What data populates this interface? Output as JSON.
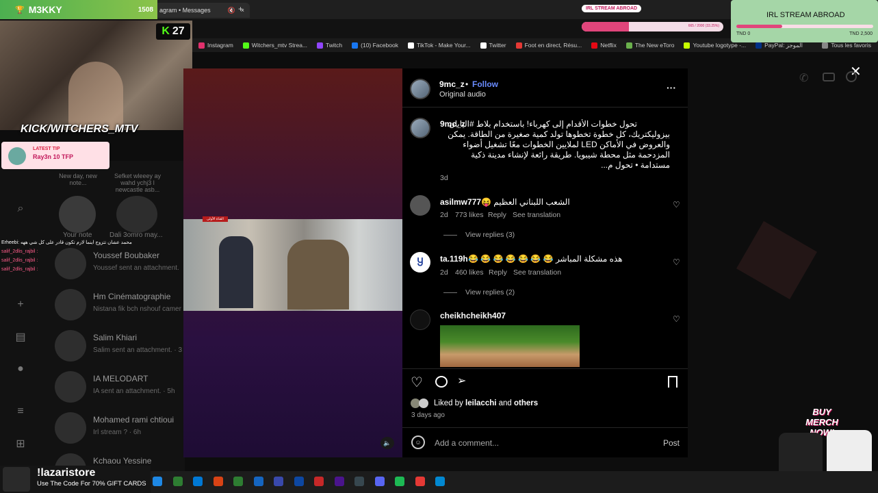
{
  "stream": {
    "name": "M3KKY",
    "count": "1508",
    "cam_badge": "27",
    "kick_handle": "KICK/WITCHERS_MTV",
    "tip_label": "LATEST TIP",
    "tip_value": "Ray3n 10 TFP",
    "abroad_small": "IRL STREAM ABROAD",
    "abroad_big": "IRL STREAM ABROAD",
    "goal_text": "665 / 2000 (33.25%)",
    "goal_pct": 33.25,
    "goal_left": "TND 0",
    "goal_right": "TND 2,500",
    "promo_name": "!lazaristore",
    "promo_text": "Use The Code For 70% GIFT CARDS",
    "merch": "BUY MERCH NOW!"
  },
  "browser": {
    "tab_title": "agram • Messages",
    "tab_close": "×",
    "new_tab": "+"
  },
  "bookmarks": [
    "Instagram",
    "Witchers_mtv Strea...",
    "Twitch",
    "(10) Facebook",
    "TikTok - Make Your...",
    "Twitter",
    "Foot en direct, Résu...",
    "Netflix",
    "The New eToro",
    "Youtube logotype -...",
    "PayPal: الموجز",
    "Tous les favoris"
  ],
  "bookmark_colors": [
    "#e1306c",
    "#53fc18",
    "#9146ff",
    "#1877f2",
    "#fff",
    "#fff",
    "#e53935",
    "#e50914",
    "#6ab04c",
    "#c6ff00",
    "#003087",
    "#888"
  ],
  "chat": {
    "line0": "Erheebi: محمد عشان تتزوج اينما لازم تكون قادر على كل شي ههه",
    "line1": "salif_2dlis_rajbil :",
    "line2": "salif_2dlis_rajbil :",
    "line3": "salif_2dlis_rajbil :"
  },
  "dm_notes": [
    {
      "text": "New day, new note..."
    },
    {
      "text": "Sefket wleeey ay wahd ychj3 l newcastle asb..."
    }
  ],
  "dm_note_names": [
    "Your note",
    "Dali 3omro may..."
  ],
  "dm_list": [
    {
      "name": "Youssef Boubaker",
      "sub": "Youssef sent an attachment."
    },
    {
      "name": "Hm Cinématographie",
      "sub": "Nistana fik bch nshouf camer"
    },
    {
      "name": "Salim Khiari",
      "sub": "Salim sent an attachment. · 3"
    },
    {
      "name": "IA MELODART",
      "sub": "IA sent an attachment. · 5h"
    },
    {
      "name": "Mohamed rami chtioui",
      "sub": "Irl stream ? · 6h"
    },
    {
      "name": "Kchaou Yessine",
      "sub": ""
    }
  ],
  "media": {
    "video_tag": "القناة الأولى",
    "mute": "🔈"
  },
  "post": {
    "author": "9mc_z",
    "dot": "•",
    "follow": "Follow",
    "audio": "Original audio",
    "more": "···",
    "caption_user": "9mc_z",
    "caption_text": "تحول خطوات الأقدام إلى كهرباء! باستخدام بلاط #اليابان بيزوليكتريك، كل خطوة تخطوها تولد كمية صغيرة من الطاقة. يمكن والعروض في الأماكن LED لملايين الخطوات معًا تشغيل أضواء المزدحمة مثل محطة شيبويا. طريقة رائعة لإنشاء مدينة ذكية مستدامة • تحول م...",
    "caption_time": "3d",
    "comments": [
      {
        "user": "asilmw777",
        "text": "😝 الشعب اللبناني العظيم",
        "time": "2d",
        "likes": "773 likes",
        "reply": "Reply",
        "translate": "See translation",
        "view": "View replies (3)"
      },
      {
        "user": "ta.119h",
        "text": "😂 😂 😂 😂 😂 😂 😂 هذه مشكلة المباشر",
        "time": "2d",
        "likes": "460 likes",
        "reply": "Reply",
        "translate": "See translation",
        "view": "View replies (2)"
      },
      {
        "user": "cheikhcheikh407",
        "text": "",
        "time": "",
        "likes": "",
        "reply": "",
        "translate": "",
        "view": ""
      }
    ],
    "liked_prefix": "Liked by",
    "liked_user": "leilacchi",
    "liked_and": "and",
    "liked_others": "others",
    "date": "3 days ago",
    "add_comment": "Add a comment...",
    "post_btn": "Post"
  }
}
